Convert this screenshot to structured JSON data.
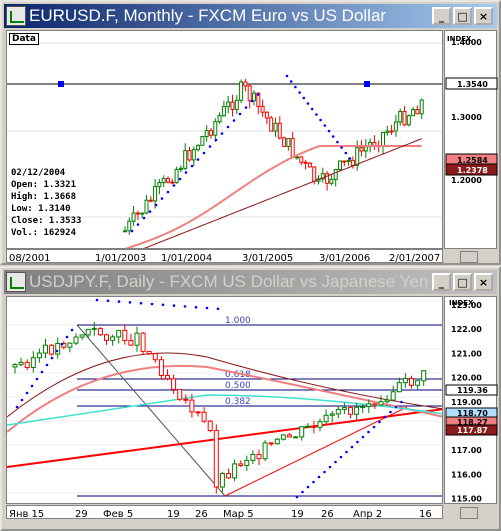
{
  "window1": {
    "title": "EURUSD.F, Monthly - FXCM Euro vs US Dollar",
    "data_label": "Data",
    "info": {
      "date": "02/12/2004",
      "open": "Open: 1.3321",
      "high": "High: 1.3668",
      "low": "Low: 1.3140",
      "close": "Close: 1.3533",
      "vol": "Vol.: 162924"
    },
    "yticks": [
      "1.4000",
      "1.3000",
      "1.2000"
    ],
    "axis_label": "INDEX",
    "price_tags": [
      {
        "label": "1.3540",
        "color": "#ffffff",
        "text": "#000000"
      },
      {
        "label": "1.2584",
        "color": "#f08080",
        "text": "#000000"
      },
      {
        "label": "1.2378",
        "color": "#8b1a1a",
        "text": "#ffffff"
      }
    ],
    "xticks": [
      "08/2001",
      "1/01/2003",
      "1/01/2004",
      "3/01/2005",
      "3/01/2006",
      "2/01/2007"
    ]
  },
  "window2": {
    "title": "USDJPY.F, Daily - FXCM US Dollar vs Japanese Yen",
    "yticks": [
      "123.00",
      "122.00",
      "121.00",
      "120.00",
      "119.00",
      "118.00",
      "117.00",
      "116.00",
      "115.00"
    ],
    "axis_label": "INDEX",
    "price_tags": [
      {
        "label": "119.36",
        "color": "#ffffff",
        "text": "#000000"
      },
      {
        "label": "118.70",
        "color": "#b0e0ff",
        "text": "#000000"
      },
      {
        "label": "118.27",
        "color": "#f08080",
        "text": "#000000"
      },
      {
        "label": "117.87",
        "color": "#8b1a1a",
        "text": "#ffffff"
      }
    ],
    "fib_labels": [
      "1.000",
      "0.618",
      "0.500",
      "0.382"
    ],
    "xticks": [
      "Янв 15",
      "29",
      "Фев 5",
      "19",
      "26",
      "Мар 5",
      "19",
      "26",
      "Апр 2",
      "16"
    ]
  },
  "buttons": {
    "minimize": "_",
    "maximize": "□",
    "close": "×"
  },
  "colors": {
    "up": "#008000",
    "down": "#ff0000",
    "title_active": "#0a246a"
  }
}
